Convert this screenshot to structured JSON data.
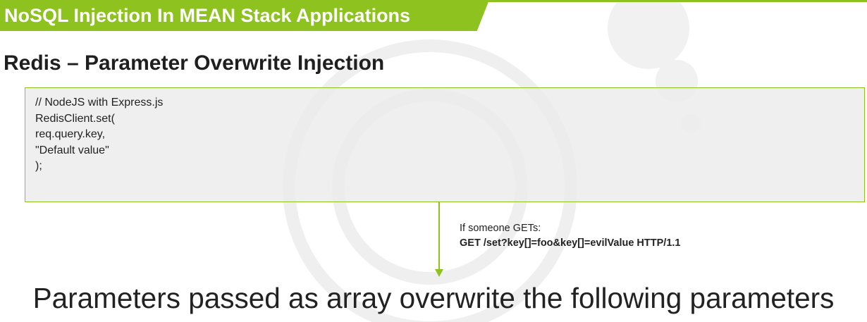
{
  "header": {
    "title": "NoSQL Injection In MEAN Stack Applications",
    "accent_color": "#8dc21f"
  },
  "section": {
    "title": "Redis – Parameter Overwrite Injection"
  },
  "code": {
    "lines": [
      "// NodeJS with Express.js",
      "RedisClient.set(",
      "req.query.key,",
      "\"Default value\"",
      ");"
    ]
  },
  "note": {
    "intro": "If someone GETs:",
    "request": "GET /set?key[]=foo&key[]=evilValue HTTP/1.1"
  },
  "conclusion": {
    "text": "Parameters passed as array overwrite the following parameters"
  },
  "icons": {
    "arrow": "arrow-down-icon",
    "watermark": "logo-watermark"
  }
}
